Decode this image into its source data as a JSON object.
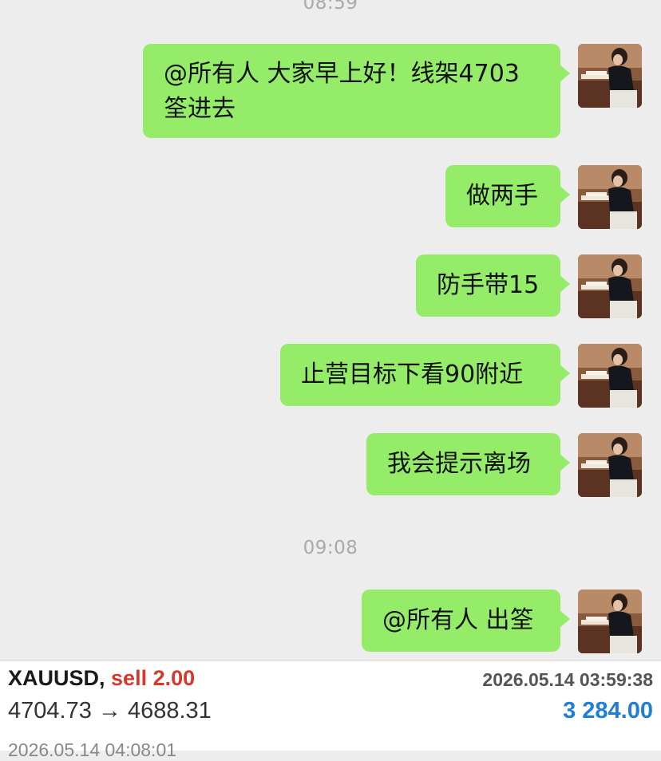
{
  "chat": {
    "time_top": "08:59",
    "messages": [
      {
        "lines": [
          "@所有人 大家早上好！线架4703",
          "筌进去"
        ]
      },
      {
        "lines": [
          "做两手"
        ]
      },
      {
        "lines": [
          "防手带15"
        ]
      },
      {
        "lines": [
          "止营目标下看90附近"
        ]
      },
      {
        "lines": [
          "我会提示离场"
        ]
      }
    ],
    "time_mid": "09:08",
    "last_message": "@所有人 出筌"
  },
  "deal": {
    "symbol": "XAUUSD,",
    "side": "sell 2.00",
    "open_time": "2026.05.14 03:59:38",
    "prices": "4704.73 → 4688.31",
    "profit": "3 284.00",
    "close_time": "2026.05.14 04:08:01"
  }
}
